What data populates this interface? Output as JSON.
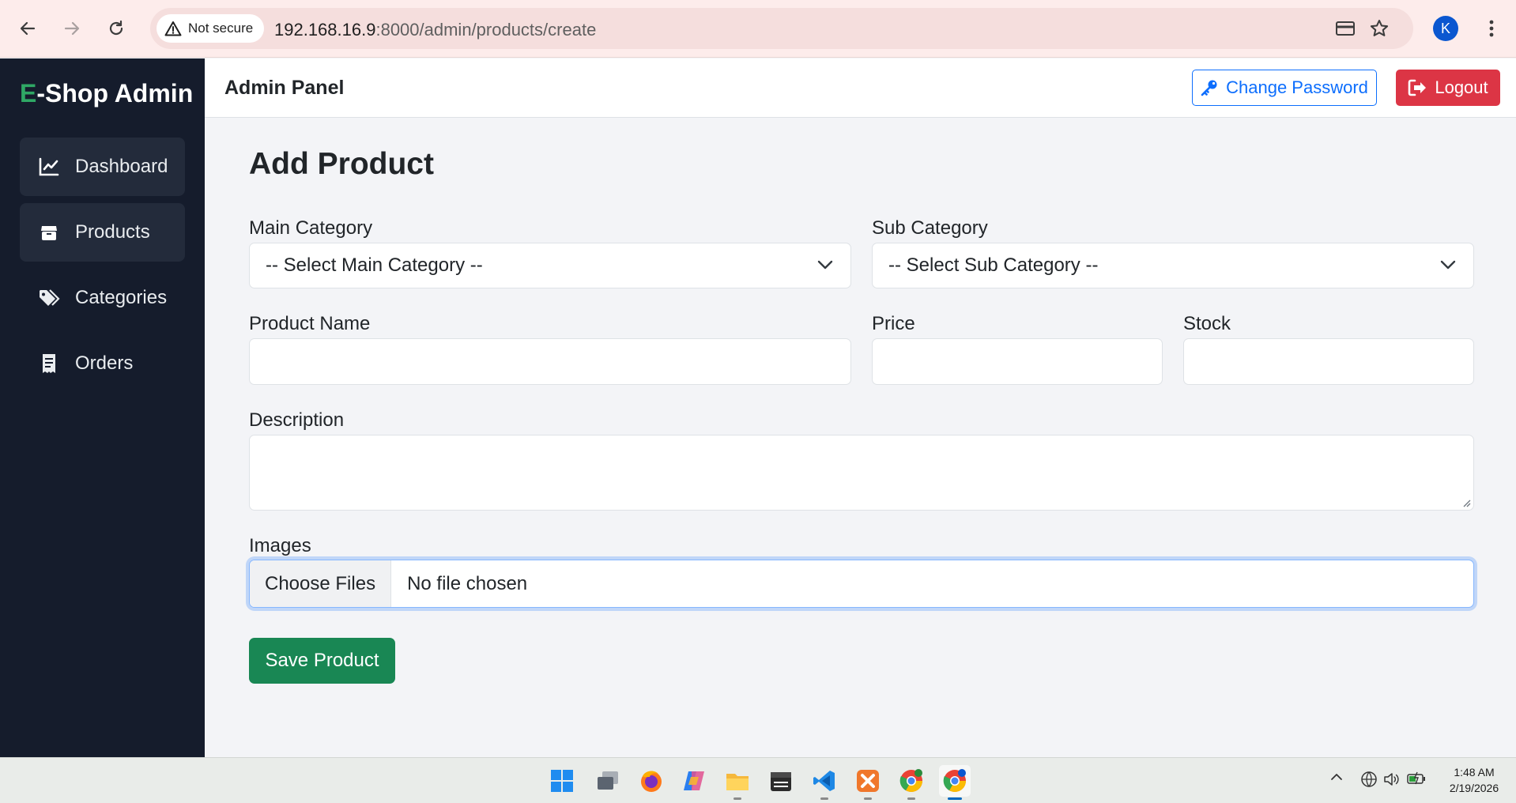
{
  "browser": {
    "security_label": "Not secure",
    "url_host": "192.168.16.9",
    "url_rest": ":8000/admin/products/create",
    "profile_initial": "K"
  },
  "sidebar": {
    "brand_accent": "E",
    "brand_rest": "-Shop Admin",
    "items": [
      {
        "label": "Dashboard",
        "icon": "chart-line-icon",
        "active": true
      },
      {
        "label": "Products",
        "icon": "box-icon",
        "active": true
      },
      {
        "label": "Categories",
        "icon": "tags-icon",
        "active": false
      },
      {
        "label": "Orders",
        "icon": "receipt-icon",
        "active": false
      }
    ]
  },
  "topbar": {
    "title": "Admin Panel",
    "change_password": "Change Password",
    "logout": "Logout"
  },
  "form": {
    "title": "Add Product",
    "main_category": {
      "label": "Main Category",
      "value": "-- Select Main Category --"
    },
    "sub_category": {
      "label": "Sub Category",
      "value": "-- Select Sub Category --"
    },
    "product_name": {
      "label": "Product Name",
      "value": ""
    },
    "price": {
      "label": "Price",
      "value": ""
    },
    "stock": {
      "label": "Stock",
      "value": ""
    },
    "description": {
      "label": "Description",
      "value": ""
    },
    "images": {
      "label": "Images",
      "button": "Choose Files",
      "status": "No file chosen"
    },
    "submit": "Save Product"
  },
  "taskbar": {
    "time": "1:48 AM",
    "date": "2/19/2026",
    "pinned": [
      "windows-start-icon",
      "task-view-icon",
      "firefox-icon",
      "copilot-icon",
      "file-explorer-icon",
      "calendar-app-icon",
      "vscode-icon",
      "xampp-icon",
      "chrome-icon",
      "chrome-profile-icon"
    ]
  },
  "colors": {
    "sidebar_bg": "#151c2c",
    "brand_accent": "#2fa865",
    "primary": "#0d6efd",
    "danger": "#dc3545",
    "success": "#198754",
    "page_bg": "#f3f4f7"
  }
}
